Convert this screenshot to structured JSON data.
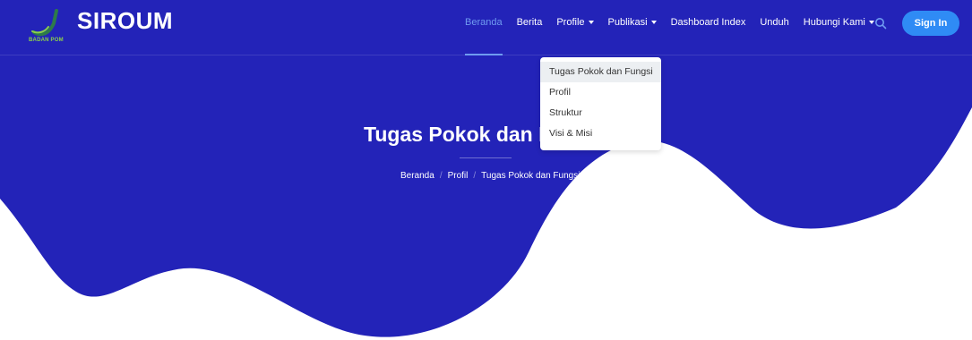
{
  "brand": {
    "name": "SIROUM",
    "logo_text": "BADAN POM"
  },
  "nav": {
    "items": [
      {
        "label": "Beranda",
        "active": true,
        "caret": false
      },
      {
        "label": "Berita",
        "active": false,
        "caret": false
      },
      {
        "label": "Profile",
        "active": false,
        "caret": true
      },
      {
        "label": "Publikasi",
        "active": false,
        "caret": true
      },
      {
        "label": "Dashboard Index",
        "active": false,
        "caret": false
      },
      {
        "label": "Unduh",
        "active": false,
        "caret": false
      },
      {
        "label": "Hubungi Kami",
        "active": false,
        "caret": true
      }
    ],
    "search_icon": "search-icon",
    "signin_label": "Sign In"
  },
  "dropdown": {
    "items": [
      {
        "label": "Tugas Pokok dan Fungsi",
        "selected": true
      },
      {
        "label": "Profil",
        "selected": false
      },
      {
        "label": "Struktur",
        "selected": false
      },
      {
        "label": "Visi & Misi",
        "selected": false
      }
    ]
  },
  "hero": {
    "title": "Tugas Pokok dan Fungsi",
    "breadcrumb": [
      "Beranda",
      "Profil",
      "Tugas Pokok dan Fungsi"
    ],
    "breadcrumb_separator": "/"
  },
  "colors": {
    "hero_bg": "#2323b8",
    "accent": "#6f9bf0",
    "button": "#2f8bf5",
    "logo_green": "#8bd04b"
  }
}
